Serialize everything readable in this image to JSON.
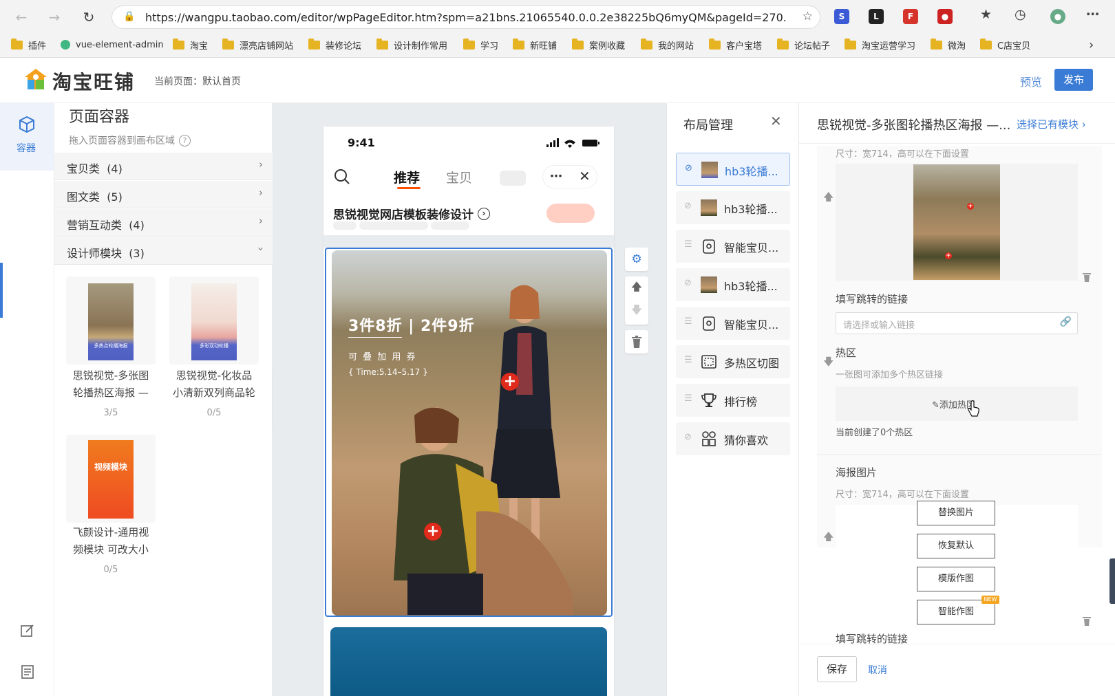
{
  "browser": {
    "url": "https://wangpu.taobao.com/editor/wpPageEditor.htm?spm=a21bns.21065540.0.0.2e38225bQ6myQM&pageId=270...",
    "bookmarks": [
      "插件",
      "vue-element-admin",
      "淘宝",
      "漂亮店铺网站",
      "装修论坛",
      "设计制作常用",
      "学习",
      "新旺铺",
      "案例收藏",
      "我的网站",
      "客户宝塔",
      "论坛帖子",
      "淘宝运营学习",
      "微淘",
      "C店宝贝"
    ]
  },
  "header": {
    "logo_text": "淘宝旺铺",
    "current_page": "当前页面：默认首页",
    "preview_label": "预览",
    "publish_label": "发布"
  },
  "rail": {
    "container_label": "容器"
  },
  "panel": {
    "title": "页面容器",
    "hint": "拖入页面容器到画布区域",
    "categories": [
      {
        "label": "宝贝类",
        "count": "(4)"
      },
      {
        "label": "图文类",
        "count": "(5)"
      },
      {
        "label": "营销互动类",
        "count": "(4)"
      },
      {
        "label": "设计师模块",
        "count": "(3)"
      }
    ],
    "tiles": [
      {
        "name_line1": "思锐视觉-多张图",
        "name_line2": "轮播热区海报 —",
        "count": "3/5",
        "thumb_text": "多热点轮播海报"
      },
      {
        "name_line1": "思锐视觉-化妆品",
        "name_line2": "小清新双列商品轮",
        "count": "0/5",
        "thumb_text": "多彩双动轮播"
      },
      {
        "name_line1": "飞颜设计-通用视",
        "name_line2": "频模块 可改大小",
        "count": "0/5",
        "thumb_text": "视频模块"
      }
    ]
  },
  "phone": {
    "time": "9:41",
    "tab_recommend": "推荐",
    "tab_items": "宝贝",
    "shop_name": "思锐视觉网店模板装修设计",
    "poster_title": "3件8折 | 2件9折",
    "poster_sub": "可 叠 加 用 券",
    "poster_time": "{ Time:5.14–5.17 }"
  },
  "layout": {
    "title": "布局管理",
    "items": [
      {
        "label": "hb3轮播...",
        "icon": "image-thumb",
        "active": true
      },
      {
        "label": "hb3轮播...",
        "icon": "image-thumb",
        "active": false
      },
      {
        "label": "智能宝贝...",
        "icon": "smart-item-icon",
        "active": false
      },
      {
        "label": "hb3轮播...",
        "icon": "image-thumb",
        "active": false
      },
      {
        "label": "智能宝贝...",
        "icon": "smart-item-icon",
        "active": false
      },
      {
        "label": "多热区切图",
        "icon": "hotzone-icon",
        "active": false
      },
      {
        "label": "排行榜",
        "icon": "trophy-icon",
        "active": false
      },
      {
        "label": "猜你喜欢",
        "icon": "guess-icon",
        "active": false
      }
    ]
  },
  "props": {
    "title": "思锐视觉-多张图轮播热区海报 —...",
    "choose_link": "选择已有模块",
    "size_hint_1": "尺寸：宽714，高可以在下面设置",
    "link_label_1": "填写跳转的链接",
    "link_placeholder": "请选择或输入链接",
    "hotzone_label": "热区",
    "hotzone_hint": "一张图可添加多个热区链接",
    "add_hotzone": "添加热区",
    "hotzone_count": "当前创建了0个热区",
    "poster_label": "海报图片",
    "size_hint_2": "尺寸：宽714，高可以在下面设置",
    "btn_replace": "替换图片",
    "btn_restore": "恢复默认",
    "btn_template": "模版作图",
    "btn_smart": "智能作图",
    "new_badge": "NEW",
    "link_label_2": "填写跳转的链接",
    "save": "保存",
    "cancel": "取消"
  },
  "colors": {
    "accent": "#3a7bd5",
    "publish_bg": "#3a7bd5",
    "plus_red": "#e02a1b"
  }
}
